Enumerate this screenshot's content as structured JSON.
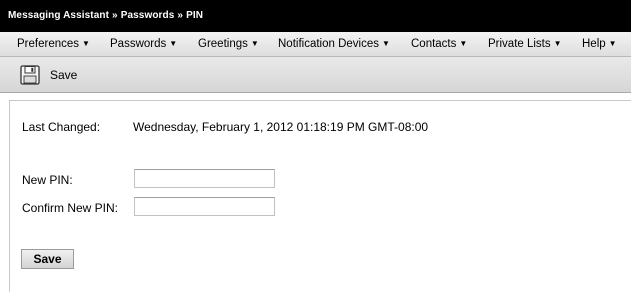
{
  "breadcrumb": {
    "items": [
      "Messaging Assistant",
      "Passwords",
      "PIN"
    ],
    "separator": "»"
  },
  "menu": {
    "items": [
      {
        "label": "Preferences"
      },
      {
        "label": "Passwords"
      },
      {
        "label": "Greetings"
      },
      {
        "label": "Notification Devices"
      },
      {
        "label": "Contacts"
      },
      {
        "label": "Private Lists"
      },
      {
        "label": "Help"
      }
    ],
    "arrow_glyph": "▼"
  },
  "toolbar": {
    "save_label": "Save",
    "save_icon": "floppy-disk-icon"
  },
  "form": {
    "last_changed_label": "Last Changed:",
    "last_changed_value": "Wednesday, February 1, 2012 01:18:19 PM GMT-08:00",
    "new_pin_label": "New PIN:",
    "new_pin_value": "",
    "confirm_pin_label": "Confirm New PIN:",
    "confirm_pin_value": "",
    "save_button_label": "Save"
  },
  "colors": {
    "title_bar_bg": "#000000",
    "title_bar_text": "#ffffff",
    "menu_bar_bg": "#e6e6e6"
  }
}
